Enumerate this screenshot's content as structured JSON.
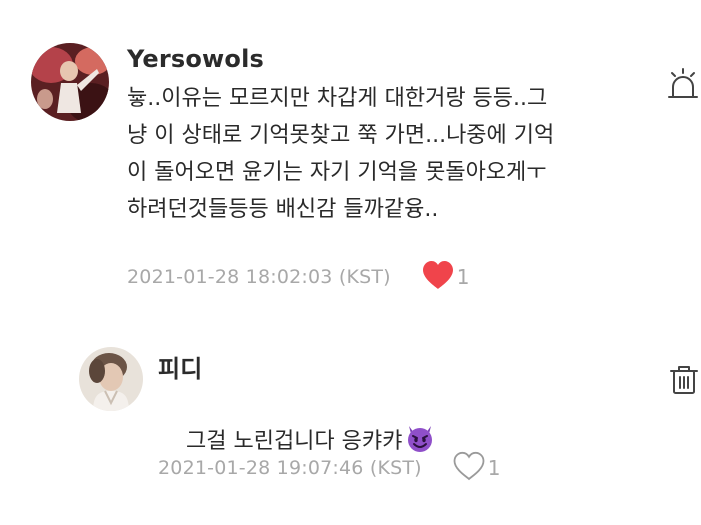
{
  "comments": [
    {
      "author": "Yersowols",
      "text": "늏..이유는 모르지만 차갑게 대한거랑 등등..그\n냥 이 상태로 기억못찾고 쭉 가면...나중에 기억\n이 돌어오면 윤기는 자기 기억을 못돌아오게ㅜ\n하려던것들등등 배신감 들까같융..",
      "timestamp": "2021-01-28 18:02:03 (KST)",
      "like_count": "1",
      "liked": true,
      "like_color": "#f0444b",
      "action_icon": "report-siren-icon"
    },
    {
      "author": "피디",
      "text": "그걸 노린겁니다 응캬캬",
      "emoji": "smiling-devil-emoji",
      "timestamp": "2021-01-28 19:07:46 (KST)",
      "like_count": "1",
      "liked": false,
      "action_icon": "trash-icon"
    }
  ]
}
